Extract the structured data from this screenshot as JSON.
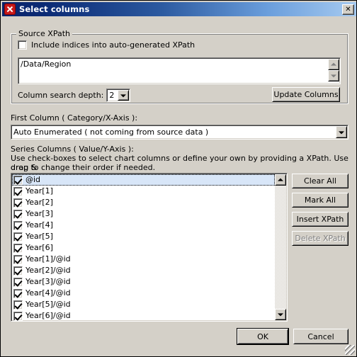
{
  "window": {
    "title": "Select columns",
    "icon": "app-x-icon",
    "close_label": "✕"
  },
  "source_xpath": {
    "legend": "Source XPath",
    "include_indices": {
      "label": "Include indices into auto-generated XPath",
      "checked": false
    },
    "xpath_value": "/Data/Region",
    "depth": {
      "label": "Column search depth:",
      "value": "2"
    },
    "update_button": "Update Columns"
  },
  "first_column": {
    "label": "First Column ( Category/X-Axis ):",
    "value": "Auto Enumerated ( not coming from source data )"
  },
  "series_columns": {
    "label": "Series Columns ( Value/Y-Axis ):",
    "help_line_1": "Use check-boxes to select chart columns or define your own by providing a XPath. Use drag &",
    "help_line_2": "drop to change their order if needed.",
    "items": [
      {
        "label": "@id",
        "checked": true,
        "selected": true
      },
      {
        "label": "Year[1]",
        "checked": true,
        "selected": false
      },
      {
        "label": "Year[2]",
        "checked": true,
        "selected": false
      },
      {
        "label": "Year[3]",
        "checked": true,
        "selected": false
      },
      {
        "label": "Year[4]",
        "checked": true,
        "selected": false
      },
      {
        "label": "Year[5]",
        "checked": true,
        "selected": false
      },
      {
        "label": "Year[6]",
        "checked": true,
        "selected": false
      },
      {
        "label": "Year[1]/@id",
        "checked": true,
        "selected": false
      },
      {
        "label": "Year[2]/@id",
        "checked": true,
        "selected": false
      },
      {
        "label": "Year[3]/@id",
        "checked": true,
        "selected": false
      },
      {
        "label": "Year[4]/@id",
        "checked": true,
        "selected": false
      },
      {
        "label": "Year[5]/@id",
        "checked": true,
        "selected": false
      },
      {
        "label": "Year[6]/@id",
        "checked": true,
        "selected": false
      }
    ]
  },
  "side_buttons": {
    "clear_all": "Clear All",
    "mark_all": "Mark All",
    "insert_xpath": "Insert XPath",
    "delete_xpath": "Delete XPath",
    "delete_xpath_disabled": true
  },
  "footer": {
    "ok": "OK",
    "cancel": "Cancel"
  },
  "colors": {
    "dialog_face": "#d4d0c8",
    "title_gradient_start": "#0a246a",
    "title_gradient_end": "#a6caf0",
    "selection": "#d8e6f8",
    "app_icon": "#c81a1a"
  }
}
